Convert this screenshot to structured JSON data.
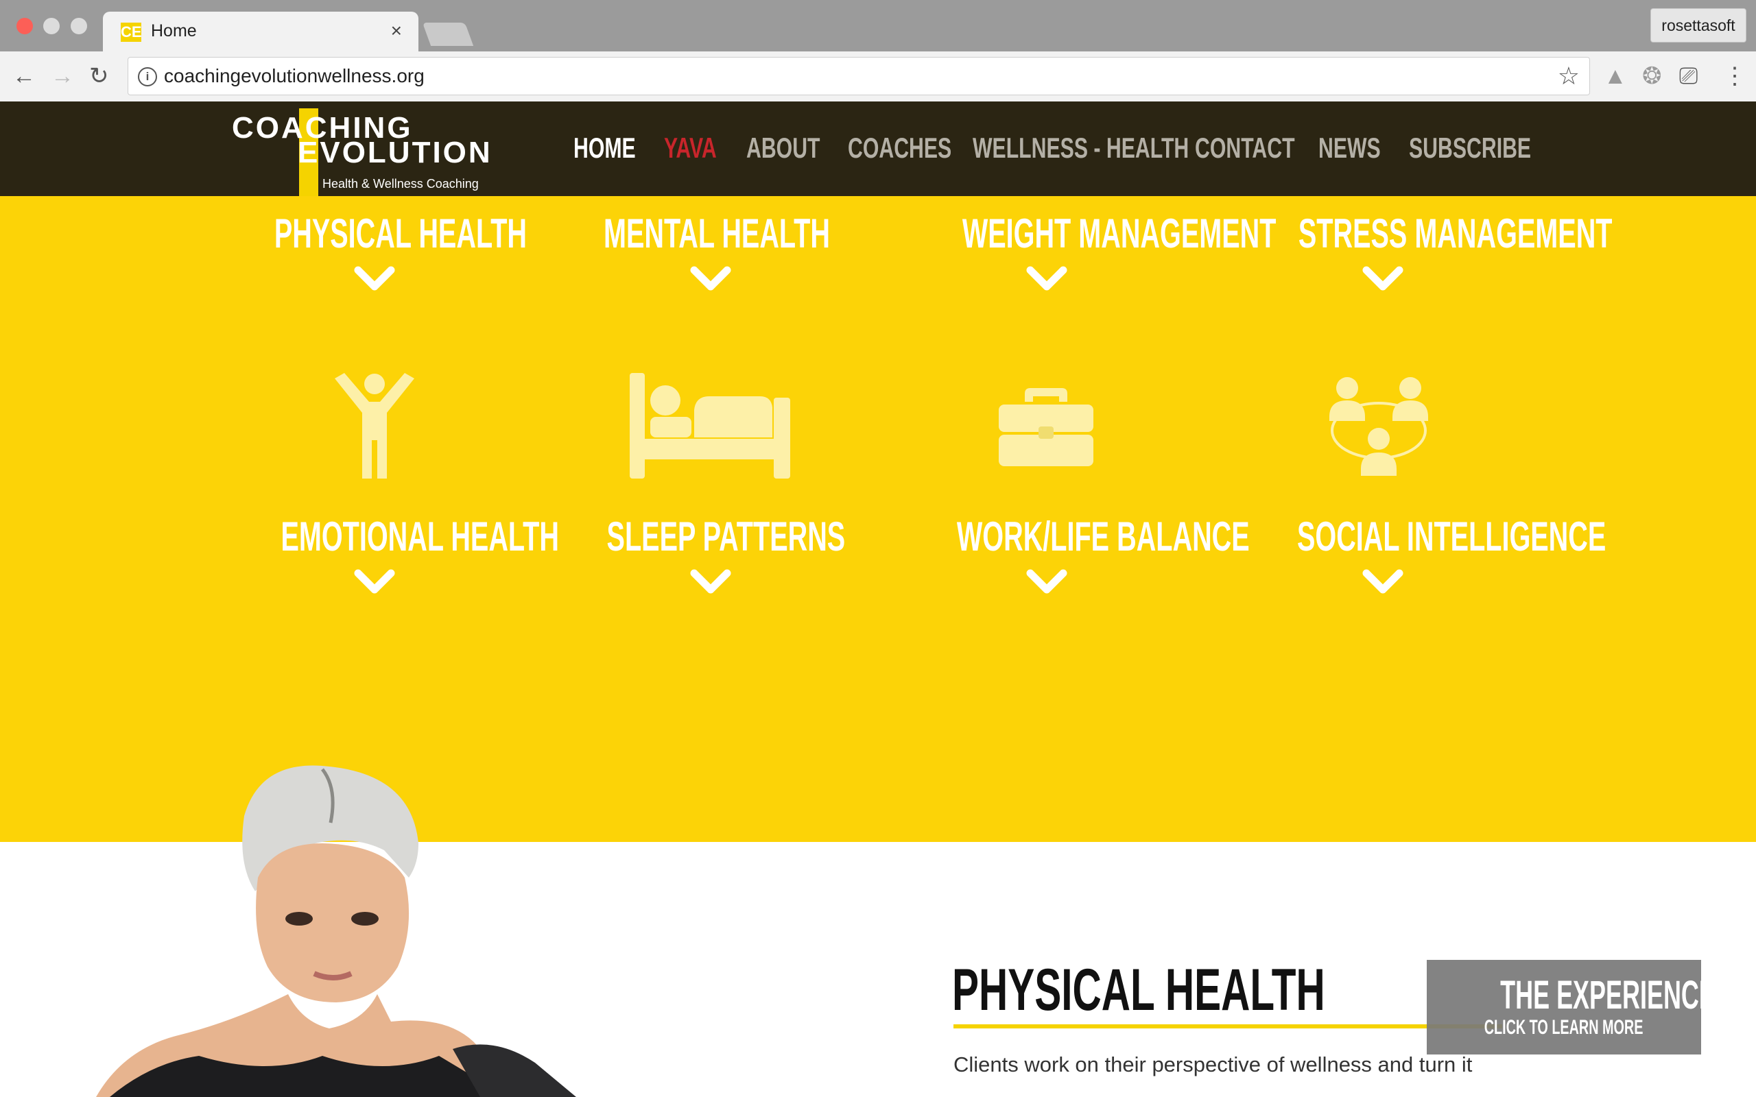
{
  "browser": {
    "tab_title": "Home",
    "tab_favicon": "CE",
    "url": "coachingevolutionwellness.org",
    "profile": "rosettasoft"
  },
  "site": {
    "logo": {
      "line1": "COACHING",
      "line2": "EVOLUTION",
      "tagline": "Health & Wellness Coaching"
    },
    "nav": [
      "HOME",
      "YAVA",
      "ABOUT",
      "COACHES",
      "WELLNESS - HEALTH",
      "CONTACT",
      "NEWS",
      "SUBSCRIBE"
    ]
  },
  "categories_top": [
    "PHYSICAL HEALTH",
    "MENTAL HEALTH",
    "WEIGHT MANAGEMENT",
    "STRESS MANAGEMENT"
  ],
  "categories_bottom": [
    "EMOTIONAL HEALTH",
    "SLEEP PATTERNS",
    "WORK/LIFE BALANCE",
    "SOCIAL INTELLIGENCE"
  ],
  "content": {
    "title": "PHYSICAL HEALTH",
    "text": "Clients work on their perspective of wellness and turn it"
  },
  "experience": {
    "title": "THE EXPERIENCE™",
    "subtitle": "CLICK TO LEARN MORE"
  },
  "colors": {
    "brand_yellow": "#fcd307",
    "header_dark": "#2b2513",
    "active_nav": "#c8252b"
  },
  "icons": [
    "person-arms-up-icon",
    "bed-icon",
    "briefcase-icon",
    "social-network-icon"
  ]
}
